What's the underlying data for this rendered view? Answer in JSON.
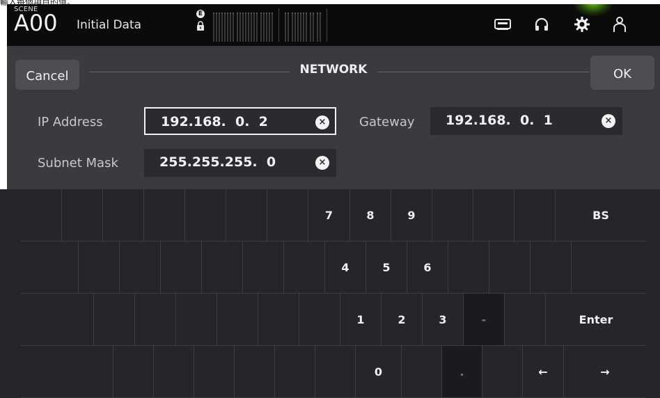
{
  "caption": "輸入每個項目的值。",
  "header": {
    "scene_label": "SCENE",
    "scene_number": "A00",
    "scene_title": "Initial Data",
    "badge": "E",
    "icons": [
      "recorder-icon",
      "headphones-icon",
      "gear-icon",
      "user-icon"
    ]
  },
  "dialog": {
    "title": "NETWORK",
    "cancel_label": "Cancel",
    "ok_label": "OK",
    "clear_glyph": "×",
    "fields": {
      "ip_label": "IP Address",
      "ip_value": "192.168.  0.  2",
      "gateway_label": "Gateway",
      "gateway_value": "192.168.  0.  1",
      "subnet_label": "Subnet Mask",
      "subnet_value": "255.255.255.  0"
    }
  },
  "keyboard": {
    "row1": {
      "k7": "7",
      "k8": "8",
      "k9": "9",
      "bs": "BS"
    },
    "row2": {
      "k4": "4",
      "k5": "5",
      "k6": "6"
    },
    "row3": {
      "k1": "1",
      "k2": "2",
      "k3": "3",
      "dash": "-",
      "enter": "Enter"
    },
    "row4": {
      "k0": "0",
      "dot": ".",
      "left": "←",
      "right": "→"
    }
  },
  "colors": {
    "accent_glow": "#7ed321",
    "panel": "#3a3b3f",
    "keyboard_bg": "#25262a"
  }
}
